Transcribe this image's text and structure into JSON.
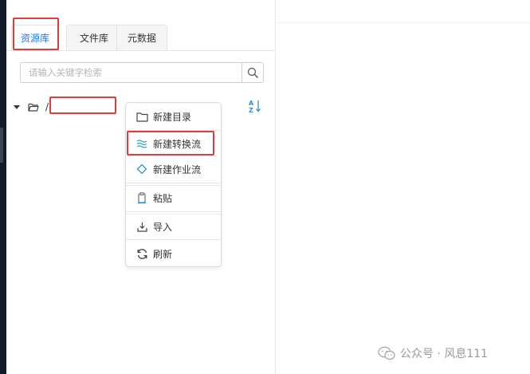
{
  "tabs": [
    {
      "label": "资源库",
      "active": true
    },
    {
      "label": "文件库",
      "active": false
    },
    {
      "label": "元数据",
      "active": false
    }
  ],
  "search": {
    "placeholder": "请输入关键字检索",
    "value": ""
  },
  "tree": {
    "root_label": "/",
    "root_name": "",
    "expanded": true
  },
  "context_menu": {
    "items": [
      {
        "label": "新建目录",
        "icon": "folder-outline-icon"
      },
      {
        "label": "新建转换流",
        "icon": "waves-icon",
        "highlighted": true
      },
      {
        "label": "新建作业流",
        "icon": "diamond-icon"
      },
      {
        "label": "粘贴",
        "icon": "paste-icon"
      },
      {
        "label": "导入",
        "icon": "import-icon"
      },
      {
        "label": "刷新",
        "icon": "refresh-icon"
      }
    ]
  },
  "watermark": {
    "text": "公众号 · 风息111"
  },
  "colors": {
    "accent": "#1e78ff",
    "highlight": "#e23b3b",
    "teal": "#2aa9b8"
  }
}
